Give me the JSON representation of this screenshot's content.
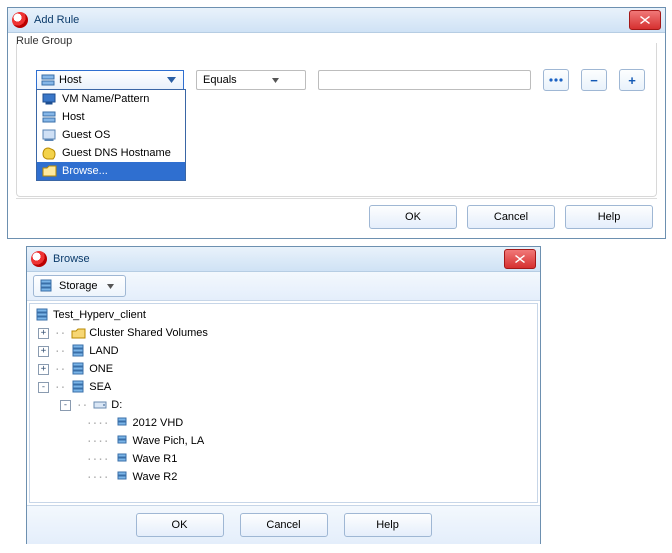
{
  "addRule": {
    "title": "Add Rule",
    "groupLabel": "Rule Group",
    "ruleTypeSelected": "Host",
    "conditionSelected": "Equals",
    "valueInput": "",
    "browseBtn": "•••",
    "removeBtn": "−",
    "addBtn": "+",
    "ok": "OK",
    "cancel": "Cancel",
    "help": "Help",
    "ruleTypeOptions": [
      {
        "label": "VM Name/Pattern",
        "icon": "vm-icon"
      },
      {
        "label": "Host",
        "icon": "host-icon"
      },
      {
        "label": "Guest OS",
        "icon": "os-icon"
      },
      {
        "label": "Guest DNS Hostname",
        "icon": "dns-icon"
      },
      {
        "label": "Browse...",
        "icon": "folder-icon",
        "selected": true
      }
    ]
  },
  "browse": {
    "title": "Browse",
    "viewSelector": "Storage",
    "ok": "OK",
    "cancel": "Cancel",
    "help": "Help",
    "tree": {
      "root": "Test_Hyperv_client",
      "l1": [
        {
          "label": "Cluster Shared Volumes",
          "icon": "folder-icon",
          "exp": "plus"
        },
        {
          "label": "LAND",
          "icon": "storage-icon",
          "exp": "plus"
        },
        {
          "label": "ONE",
          "icon": "storage-icon",
          "exp": "plus"
        },
        {
          "label": "SEA",
          "icon": "storage-icon",
          "exp": "minus"
        }
      ],
      "sea_drive": "D:",
      "sea_items": [
        "2012 VHD",
        "Wave Pich, LA",
        "Wave R1",
        "Wave R2"
      ]
    }
  }
}
